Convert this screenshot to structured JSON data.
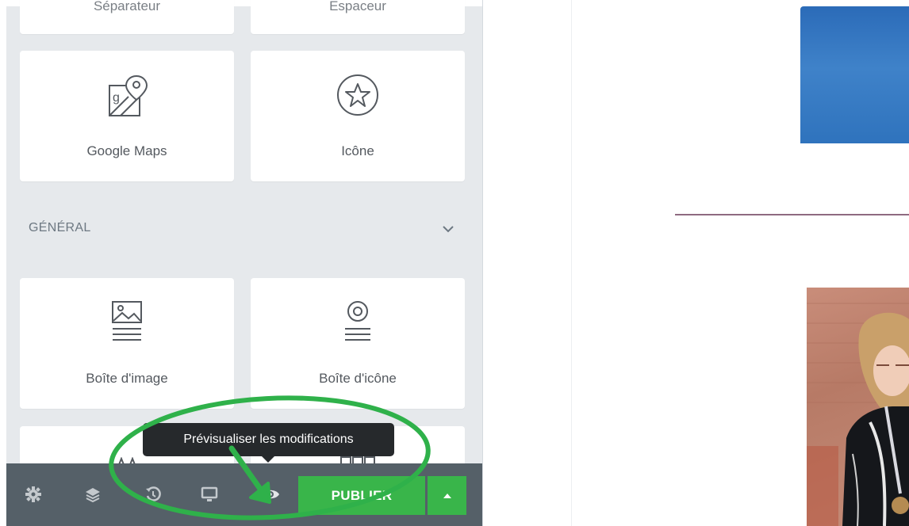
{
  "widgets_top": [
    {
      "label": "Séparateur",
      "icon": "divider-icon"
    },
    {
      "label": "Espaceur",
      "icon": "spacer-icon"
    }
  ],
  "widgets_row2": [
    {
      "label": "Google Maps",
      "icon": "map-pin-icon"
    },
    {
      "label": "Icône",
      "icon": "star-circle-icon"
    }
  ],
  "section": {
    "title": "GÉNÉRAL",
    "chevron": "chevron-down-icon"
  },
  "widgets_row3": [
    {
      "label": "Boîte d'image",
      "icon": "image-box-icon"
    },
    {
      "label": "Boîte d'icône",
      "icon": "icon-box-icon"
    }
  ],
  "toolbar": {
    "icons": [
      "settings-icon",
      "layers-icon",
      "history-icon",
      "responsive-icon",
      "preview-eye-icon"
    ],
    "publish_label": "PUBLIER",
    "tooltip": "Prévisualiser les modifications"
  },
  "colors": {
    "panel_bg": "#e6e9ec",
    "toolbar_bg": "#556068",
    "publish_green": "#39b54a",
    "annotation_green": "#2fb14a",
    "tooltip_bg": "#26292c"
  }
}
